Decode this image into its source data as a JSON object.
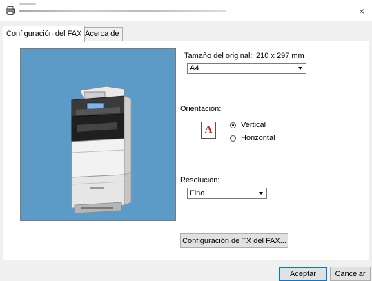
{
  "window": {
    "title_icon": "printer-icon",
    "close_icon": "close-icon",
    "close_label": "×"
  },
  "tabs": [
    {
      "label": "Configuración del FAX",
      "selected": true
    },
    {
      "label": "Acerca de",
      "selected": false
    }
  ],
  "preview": {
    "icon": "printer-device-image"
  },
  "original_size": {
    "label": "Tamaño del original:",
    "dimensions": "210 x 297 mm",
    "selected": "A4"
  },
  "orientation": {
    "label": "Orientación:",
    "icon_letter": "A",
    "options": [
      {
        "label": "Vertical",
        "checked": true
      },
      {
        "label": "Horizontal",
        "checked": false
      }
    ]
  },
  "resolution": {
    "label": "Resolución:",
    "selected": "Fino"
  },
  "tx_settings_button": "Configuración de TX del FAX...",
  "footer": {
    "ok_label": "Aceptar",
    "cancel_label": "Cancelar"
  },
  "colors": {
    "preview_background": "#5c9ac8",
    "orientation_letter": "#c1272d",
    "default_button_border": "#0078d7"
  }
}
